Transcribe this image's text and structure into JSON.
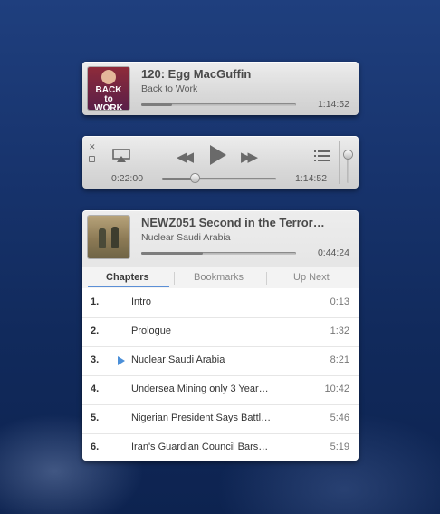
{
  "mini_player": {
    "title": "120: Egg MacGuffin",
    "podcast": "Back to Work",
    "duration": "1:14:52",
    "progress": 0.2,
    "artwork_text": "BACK to WORK"
  },
  "controls": {
    "current_time": "0:22:00",
    "total_time": "1:14:52",
    "position": 0.29,
    "volume": 1.0
  },
  "now_playing": {
    "title": "NEWZ051 Second in the Terror…",
    "chapter": "Nuclear Saudi Arabia",
    "remaining": "0:44:24",
    "progress": 0.4
  },
  "tabs": [
    {
      "label": "Chapters",
      "active": true
    },
    {
      "label": "Bookmarks",
      "active": false
    },
    {
      "label": "Up Next",
      "active": false
    }
  ],
  "chapters": [
    {
      "num": "1.",
      "name": "Intro",
      "duration": "0:13"
    },
    {
      "num": "2.",
      "name": "Prologue",
      "duration": "1:32"
    },
    {
      "num": "3.",
      "name": "Nuclear Saudi Arabia",
      "duration": "8:21",
      "playing": true
    },
    {
      "num": "4.",
      "name": "Undersea Mining only 3 Year…",
      "duration": "10:42"
    },
    {
      "num": "5.",
      "name": "Nigerian President Says Battl…",
      "duration": "5:46"
    },
    {
      "num": "6.",
      "name": "Iran's Guardian Council Bars…",
      "duration": "5:19"
    }
  ],
  "colors": {
    "accent": "#4b8fd8",
    "background": "#17336c"
  }
}
